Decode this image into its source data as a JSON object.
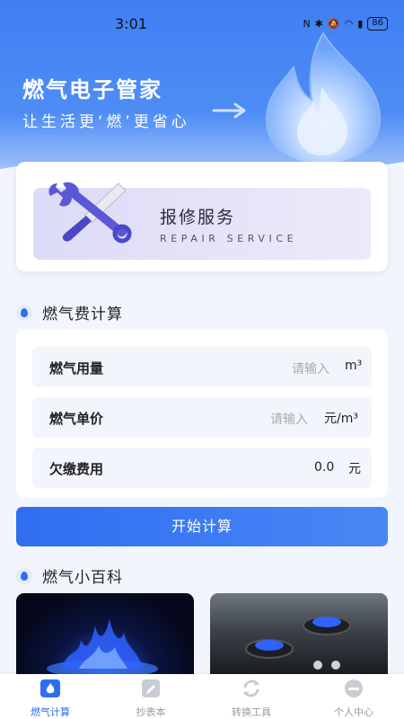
{
  "status_bar": {
    "time": "3:01",
    "battery": "86"
  },
  "hero": {
    "title": "燃气电子管家",
    "subtitle": "让生活更‘燃’更省心"
  },
  "repair": {
    "title": "报修服务",
    "subtitle_en": "REPAIR SERVICE"
  },
  "calc_section": {
    "title": "燃气费计算"
  },
  "calc": {
    "usage": {
      "label": "燃气用量",
      "placeholder": "请输入",
      "unit": "m³"
    },
    "price": {
      "label": "燃气单价",
      "placeholder": "请输入",
      "unit": "元/m³"
    },
    "arrears": {
      "label": "欠缴费用",
      "value": "0.0",
      "unit": "元"
    },
    "button": "开始计算"
  },
  "wiki_section": {
    "title": "燃气小百科"
  },
  "tabs": [
    {
      "label": "燃气计算",
      "icon": "gas-calc-icon",
      "active": true
    },
    {
      "label": "抄表本",
      "icon": "notebook-icon",
      "active": false
    },
    {
      "label": "转换工具",
      "icon": "convert-icon",
      "active": false
    },
    {
      "label": "个人中心",
      "icon": "profile-icon",
      "active": false
    }
  ],
  "colors": {
    "primary": "#2f6ef0",
    "background": "#f2f6fc",
    "repair_bg": "#e3e2f7"
  }
}
